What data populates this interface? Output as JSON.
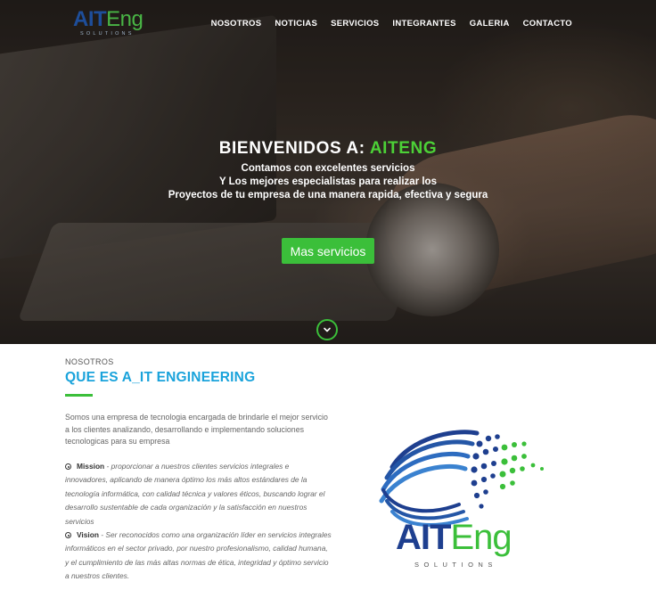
{
  "header": {
    "logo": {
      "main_part1": "AIT",
      "main_part2": "Eng",
      "sub": "SOLUTIONS"
    },
    "nav": [
      {
        "label": "NOSOTROS"
      },
      {
        "label": "NOTICIAS"
      },
      {
        "label": "SERVICIOS"
      },
      {
        "label": "INTEGRANTES"
      },
      {
        "label": "GALERIA"
      },
      {
        "label": "CONTACTO"
      }
    ]
  },
  "hero": {
    "title_prefix": "BIENVENIDOS A:",
    "title_brand": "AITENG",
    "lines": [
      "Contamos con excelentes servicios",
      "Y Los mejores especialistas para realizar los",
      "Proyectos de tu empresa de una manera rapida, efectiva y segura"
    ],
    "cta_label": "Mas servicios",
    "scroll_icon": "chevron-down-icon"
  },
  "about": {
    "eyebrow": "NOSOTROS",
    "title_prefix": "QUE ES",
    "title_strong": "A_IT ENGINEERING",
    "intro": "Somos una empresa de tecnologia encargada de brindarle el mejor servicio a los clientes analizando, desarrollando e implementando soluciones tecnologicas para su empresa",
    "mission": {
      "label": "Mission",
      "text": " - proporcionar a nuestros clientes servicios integrales e innovadores, aplicando de manera óptimo los más altos estándares de la tecnología informática, con calidad técnica y valores éticos, buscando lograr el desarrollo sustentable de cada organización y la satisfacción en nuestros servicios"
    },
    "vision": {
      "label": "Vision",
      "text": " - Ser reconocidos como una organización líder en servicios integrales informáticos en el sector privado, por nuestro profesionalismo, calidad humana, y el cumplimiento de las más altas normas de ética, integridad y óptimo servicio a nuestros clientes."
    },
    "big_logo": {
      "part1": "AIT",
      "part2": "Eng",
      "sub": "SOLUTIONS"
    }
  },
  "colors": {
    "accent_green": "#3bbf3a",
    "title_blue": "#1aa3db",
    "logo_blue": "#1e3f8f"
  }
}
